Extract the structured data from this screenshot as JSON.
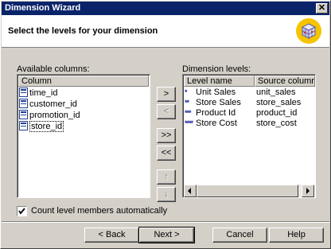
{
  "window": {
    "title": "Dimension Wizard",
    "close_glyph": "✕"
  },
  "header": {
    "title": "Select the levels for your dimension",
    "icon": "cube-wizard-icon"
  },
  "available": {
    "label": "Available columns:",
    "column_header": "Column",
    "items": [
      "time_id",
      "customer_id",
      "promotion_id",
      "store_id"
    ]
  },
  "move_buttons": {
    "add": ">",
    "remove": "<",
    "add_all": ">>",
    "remove_all": "<<",
    "move_up": "↑",
    "move_down": "↓"
  },
  "levels": {
    "label": "Dimension levels:",
    "headers": {
      "level_name": "Level name",
      "source_column": "Source column"
    },
    "rows": [
      {
        "stars": "*",
        "name": "Unit Sales",
        "source": "unit_sales"
      },
      {
        "stars": "**",
        "name": "Store Sales",
        "source": "store_sales"
      },
      {
        "stars": "***",
        "name": "Product Id",
        "source": "product_id"
      },
      {
        "stars": "****",
        "name": "Store Cost",
        "source": "store_cost"
      }
    ]
  },
  "options": {
    "count_members_label": "Count level members automatically",
    "count_members_checked": true
  },
  "footer": {
    "back": "< Back",
    "next": "Next >",
    "cancel": "Cancel",
    "help": "Help"
  }
}
